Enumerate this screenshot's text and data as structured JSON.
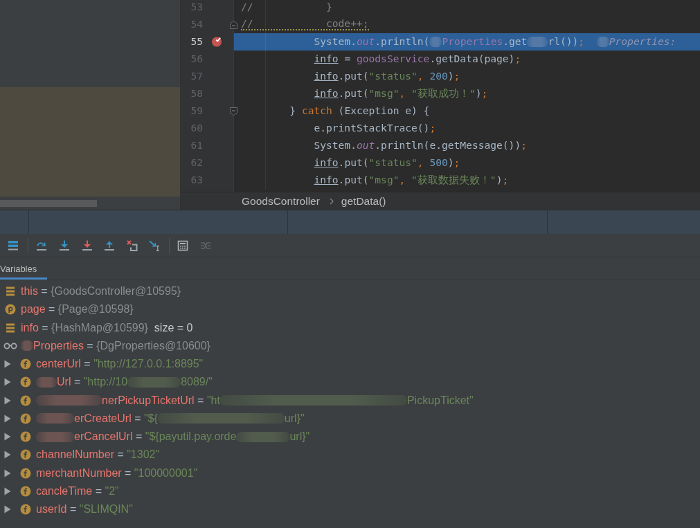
{
  "editor": {
    "lines": [
      {
        "number": "53",
        "kind": "code",
        "selected": false,
        "breakpoint": false,
        "warning": false,
        "tokens": [
          {
            "kind": "comment",
            "text": "//            }"
          }
        ]
      },
      {
        "number": "54",
        "kind": "fold_start",
        "selected": false,
        "breakpoint": false,
        "warning": true,
        "tokens": [
          {
            "kind": "comment",
            "text": "//            code++;"
          }
        ]
      },
      {
        "number": "55",
        "kind": "code",
        "selected": true,
        "breakpoint": true,
        "warning": false,
        "tokens": [
          {
            "kind": "plain",
            "text": "            System."
          },
          {
            "kind": "static",
            "text": "out"
          },
          {
            "kind": "plain",
            "text": ".println("
          },
          {
            "kind": "blur_tiny"
          },
          {
            "kind": "field",
            "text": "Properties"
          },
          {
            "kind": "plain",
            "text": ".get"
          },
          {
            "kind": "blur_small"
          },
          {
            "kind": "plain",
            "text": "rl())"
          },
          {
            "kind": "punct",
            "text": ";  "
          },
          {
            "kind": "blur_tiny"
          },
          {
            "kind": "hint",
            "text": "Properties:"
          }
        ]
      },
      {
        "number": "56",
        "kind": "code",
        "selected": false,
        "breakpoint": false,
        "warning": false,
        "tokens": [
          {
            "kind": "local",
            "text": "            info"
          },
          {
            "kind": "plain",
            "text": " = "
          },
          {
            "kind": "field",
            "text": "goodsService"
          },
          {
            "kind": "plain",
            "text": ".getData(page)"
          },
          {
            "kind": "punct",
            "text": ";"
          }
        ]
      },
      {
        "number": "57",
        "kind": "code",
        "selected": false,
        "breakpoint": false,
        "warning": false,
        "tokens": [
          {
            "kind": "local",
            "text": "            info"
          },
          {
            "kind": "plain",
            "text": ".put("
          },
          {
            "kind": "string",
            "text": "\"status\""
          },
          {
            "kind": "punct",
            "text": ", "
          },
          {
            "kind": "number",
            "text": "200"
          },
          {
            "kind": "plain",
            "text": ")"
          },
          {
            "kind": "punct",
            "text": ";"
          }
        ]
      },
      {
        "number": "58",
        "kind": "code",
        "selected": false,
        "breakpoint": false,
        "warning": false,
        "tokens": [
          {
            "kind": "local",
            "text": "            info"
          },
          {
            "kind": "plain",
            "text": ".put("
          },
          {
            "kind": "string",
            "text": "\"msg\""
          },
          {
            "kind": "punct",
            "text": ", "
          },
          {
            "kind": "string",
            "text": "\"获取成功！\""
          },
          {
            "kind": "plain",
            "text": ")"
          },
          {
            "kind": "punct",
            "text": ";"
          }
        ]
      },
      {
        "number": "59",
        "kind": "fold_end",
        "selected": false,
        "breakpoint": false,
        "warning": false,
        "tokens": [
          {
            "kind": "plain",
            "text": "        } "
          },
          {
            "kind": "keyword",
            "text": "catch"
          },
          {
            "kind": "plain",
            "text": " (Exception e) {"
          }
        ]
      },
      {
        "number": "60",
        "kind": "code",
        "selected": false,
        "breakpoint": false,
        "warning": false,
        "tokens": [
          {
            "kind": "plain",
            "text": "            e.printStackTrace()"
          },
          {
            "kind": "punct",
            "text": ";"
          }
        ]
      },
      {
        "number": "61",
        "kind": "code",
        "selected": false,
        "breakpoint": false,
        "warning": false,
        "tokens": [
          {
            "kind": "plain",
            "text": "            System."
          },
          {
            "kind": "static",
            "text": "out"
          },
          {
            "kind": "plain",
            "text": ".println(e.getMessage())"
          },
          {
            "kind": "punct",
            "text": ";"
          }
        ]
      },
      {
        "number": "62",
        "kind": "code",
        "selected": false,
        "breakpoint": false,
        "warning": false,
        "tokens": [
          {
            "kind": "local",
            "text": "            info"
          },
          {
            "kind": "plain",
            "text": ".put("
          },
          {
            "kind": "string",
            "text": "\"status\""
          },
          {
            "kind": "punct",
            "text": ", "
          },
          {
            "kind": "number",
            "text": "500"
          },
          {
            "kind": "plain",
            "text": ")"
          },
          {
            "kind": "punct",
            "text": ";"
          }
        ]
      },
      {
        "number": "63",
        "kind": "code",
        "selected": false,
        "breakpoint": false,
        "warning": false,
        "tokens": [
          {
            "kind": "local",
            "text": "            info"
          },
          {
            "kind": "plain",
            "text": ".put("
          },
          {
            "kind": "string",
            "text": "\"msg\""
          },
          {
            "kind": "punct",
            "text": ", "
          },
          {
            "kind": "string",
            "text": "\"获取数据失败！\""
          },
          {
            "kind": "plain",
            "text": ")"
          },
          {
            "kind": "punct",
            "text": ";"
          }
        ]
      }
    ],
    "breadcrumb": [
      {
        "label": "GoodsController"
      },
      {
        "label": "getData()"
      }
    ]
  },
  "debugger": {
    "toolbar": {
      "groups": [
        {
          "buttons": [
            {
              "kind": "layout",
              "disabled": false
            }
          ]
        },
        {
          "buttons": [
            {
              "kind": "step_over",
              "disabled": false
            },
            {
              "kind": "step_into",
              "disabled": false
            },
            {
              "kind": "force_step_into",
              "disabled": false
            },
            {
              "kind": "step_out",
              "disabled": false
            },
            {
              "kind": "drop_frame",
              "disabled": false
            },
            {
              "kind": "run_to_cursor",
              "disabled": false
            }
          ]
        },
        {
          "buttons": [
            {
              "kind": "evaluate",
              "disabled": false
            },
            {
              "kind": "trace_stream",
              "disabled": true
            }
          ]
        }
      ]
    },
    "tabs": [
      {
        "label": "Variables",
        "selected": true
      }
    ],
    "variables": [
      {
        "kind": "local",
        "tokens": [
          {
            "kind": "name",
            "text": "this"
          },
          {
            "kind": "op",
            "text": " = "
          },
          {
            "kind": "object",
            "text": "{GoodsController@10595}"
          }
        ]
      },
      {
        "kind": "parameter",
        "tokens": [
          {
            "kind": "name",
            "text": "page"
          },
          {
            "kind": "op",
            "text": " = "
          },
          {
            "kind": "object",
            "text": "{Page@10598}"
          }
        ]
      },
      {
        "kind": "local",
        "tokens": [
          {
            "kind": "name",
            "text": "info"
          },
          {
            "kind": "op",
            "text": " = "
          },
          {
            "kind": "object",
            "text": "{HashMap@10599}"
          },
          {
            "kind": "size",
            "text": "  size = 0"
          }
        ]
      },
      {
        "kind": "watch",
        "tokens": [
          {
            "kind": "blur_tiny"
          },
          {
            "kind": "name",
            "text": "Properties"
          },
          {
            "kind": "op",
            "text": " = "
          },
          {
            "kind": "object",
            "text": "{DgProperties@10600}"
          }
        ],
        "children": [
          {
            "kind": "field",
            "expanded": false,
            "tokens": [
              {
                "kind": "name",
                "text": "centerUrl"
              },
              {
                "kind": "op",
                "text": " = "
              },
              {
                "kind": "string",
                "text": "\"http://127.0.0.1:8895\""
              }
            ]
          },
          {
            "kind": "field",
            "expanded": false,
            "tokens": [
              {
                "kind": "blur_small"
              },
              {
                "kind": "name",
                "text": "Url"
              },
              {
                "kind": "op",
                "text": " = "
              },
              {
                "kind": "string",
                "text": "\"http://10"
              },
              {
                "kind": "blur_large"
              },
              {
                "kind": "string",
                "text": "8089/\""
              }
            ]
          },
          {
            "kind": "field",
            "expanded": false,
            "tokens": [
              {
                "kind": "blur_long"
              },
              {
                "kind": "name",
                "text": "nerPickupTicketUrl"
              },
              {
                "kind": "op",
                "text": " = "
              },
              {
                "kind": "string",
                "text": "\"ht"
              },
              {
                "kind": "blur_huge"
              },
              {
                "kind": "string",
                "text": "PickupTicket\""
              }
            ]
          },
          {
            "kind": "field",
            "expanded": false,
            "tokens": [
              {
                "kind": "blur_medium"
              },
              {
                "kind": "name",
                "text": "erCreateUrl"
              },
              {
                "kind": "op",
                "text": " = "
              },
              {
                "kind": "string",
                "text": "\"${"
              },
              {
                "kind": "blur_wide"
              },
              {
                "kind": "string",
                "text": "url}\""
              }
            ]
          },
          {
            "kind": "field",
            "expanded": false,
            "tokens": [
              {
                "kind": "blur_medium"
              },
              {
                "kind": "name",
                "text": "erCancelUrl"
              },
              {
                "kind": "op",
                "text": " = "
              },
              {
                "kind": "string",
                "text": "\"${payutil.pay.orde"
              },
              {
                "kind": "blur_large"
              },
              {
                "kind": "string",
                "text": "url}\""
              }
            ]
          },
          {
            "kind": "field",
            "expanded": false,
            "tokens": [
              {
                "kind": "name",
                "text": "channelNumber"
              },
              {
                "kind": "op",
                "text": " = "
              },
              {
                "kind": "string",
                "text": "\"1302\""
              }
            ]
          },
          {
            "kind": "field",
            "expanded": false,
            "tokens": [
              {
                "kind": "name",
                "text": "merchantNumber"
              },
              {
                "kind": "op",
                "text": " = "
              },
              {
                "kind": "string",
                "text": "\"100000001\""
              }
            ]
          },
          {
            "kind": "field",
            "expanded": false,
            "tokens": [
              {
                "kind": "name",
                "text": "cancleTime"
              },
              {
                "kind": "op",
                "text": " = "
              },
              {
                "kind": "string",
                "text": "\"2\""
              }
            ]
          },
          {
            "kind": "field",
            "expanded": false,
            "tokens": [
              {
                "kind": "name",
                "text": "userId"
              },
              {
                "kind": "op",
                "text": " = "
              },
              {
                "kind": "string",
                "text": "\"SLIMQIN\""
              }
            ]
          }
        ]
      }
    ]
  }
}
